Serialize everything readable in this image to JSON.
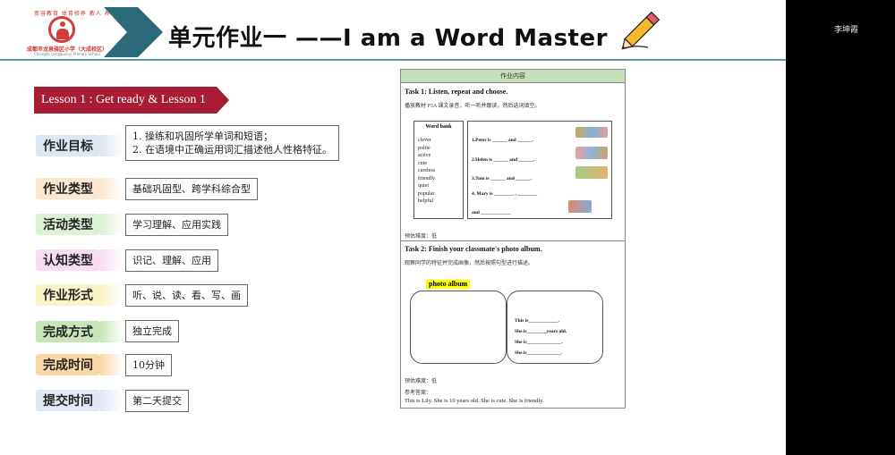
{
  "header": {
    "title": "单元作业一 ——I am a Word Master",
    "logo": {
      "top_text": "宽容教育  体育修养  教人 养艺",
      "name": "成都市龙泉驿区小学（大成校区）",
      "sub": "Chengdu Longquanyi Primary School"
    }
  },
  "participant": {
    "name": "李坤霞"
  },
  "lesson": {
    "label": "Lesson 1 : Get ready & Lesson 1"
  },
  "rows": [
    {
      "label": "作业目标",
      "color": "#dde6f3",
      "value_lines": [
        "1. 操练和巩固所学单词和短语；",
        "2. 在语境中正确运用词汇描述他人性格特征。"
      ]
    },
    {
      "label": "作业类型",
      "color": "#fde7cd",
      "value_lines": [
        "基础巩固型、跨学科综合型"
      ]
    },
    {
      "label": "活动类型",
      "color": "#ddf1d6",
      "value_lines": [
        "学习理解、应用实践"
      ]
    },
    {
      "label": "认知类型",
      "color": "#f8dcf3",
      "value_lines": [
        "识记、理解、应用"
      ]
    },
    {
      "label": "作业形式",
      "color": "#fbf3c8",
      "value_lines": [
        "听、说、读、看、写、画"
      ]
    },
    {
      "label": "完成方式",
      "color": "#c6e6b8",
      "value_lines": [
        "独立完成"
      ]
    },
    {
      "label": "完成时间",
      "color": "#fbd8a8",
      "value_lines": [
        "10分钟"
      ]
    },
    {
      "label": "提交时间",
      "color": "#e0e8f4",
      "value_lines": [
        "第二天提交"
      ]
    }
  ],
  "worksheet": {
    "heading": "作业内容",
    "task1": {
      "title": "Task 1: Listen, repeat and choose.",
      "instruction": "播放教材 P3A 课文录音，听一听并跟读，然后选词填空。",
      "wordbank_title": "Word bank",
      "words": [
        "clever",
        "polite",
        "active",
        "cute",
        "careless",
        "friendly",
        "quiet",
        "popular",
        "helpful"
      ],
      "sentences": [
        "1.Peter is ______ and ______.",
        "2.Helen is ______ and ______.",
        "3.Tom is ______ and ______.",
        "4. Mary is ________ , ________",
        "and ____________"
      ],
      "difficulty": "预估难度：低"
    },
    "task2": {
      "title": "Task 2: Finish your classmate's photo album.",
      "instruction": "观察同学的特征并完成画像，然后按照句型进行描述。",
      "album_label": "photo album",
      "lines": [
        "This is____________.",
        "She is________years old.",
        "She is______________.",
        "She is______________."
      ],
      "difficulty": "预估难度：低",
      "ref_label": "参考答案：",
      "answer": "This is Lily. She is 10 years old. She is cute. She is friendly."
    }
  },
  "colors": {
    "chevron": "#2b6a78",
    "lesson_tag": "#a81d34",
    "header_line": "#5b9aa0",
    "worksheet_head": "#c7dfba"
  }
}
